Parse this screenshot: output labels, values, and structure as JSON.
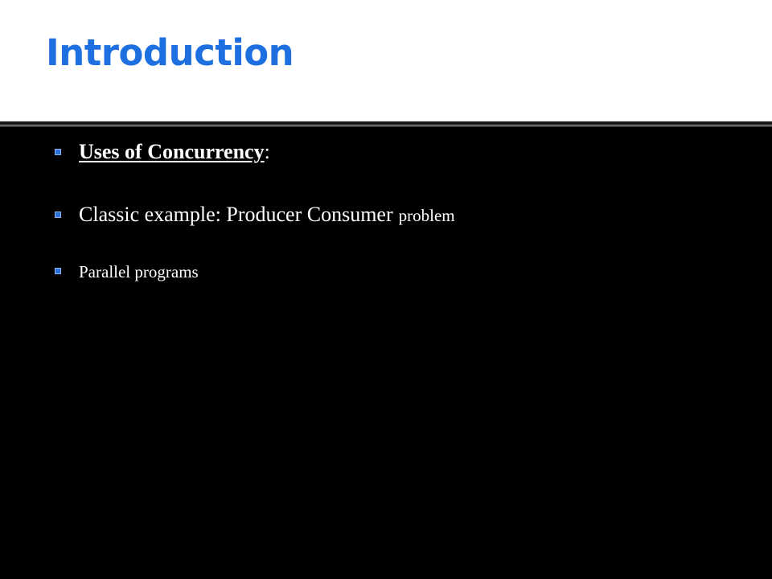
{
  "slide": {
    "title": "Introduction",
    "bullets": [
      {
        "main": "Uses of Concurrency",
        "suffix": ":"
      },
      {
        "main": "Classic example: Producer Consumer",
        "small": "problem"
      },
      {
        "main": "Parallel programs"
      }
    ]
  },
  "colors": {
    "title": "#1e6fe0",
    "background": "#000000",
    "header_band": "#ffffff",
    "bullet_marker": "#2a6fd6",
    "text": "#ffffff"
  }
}
